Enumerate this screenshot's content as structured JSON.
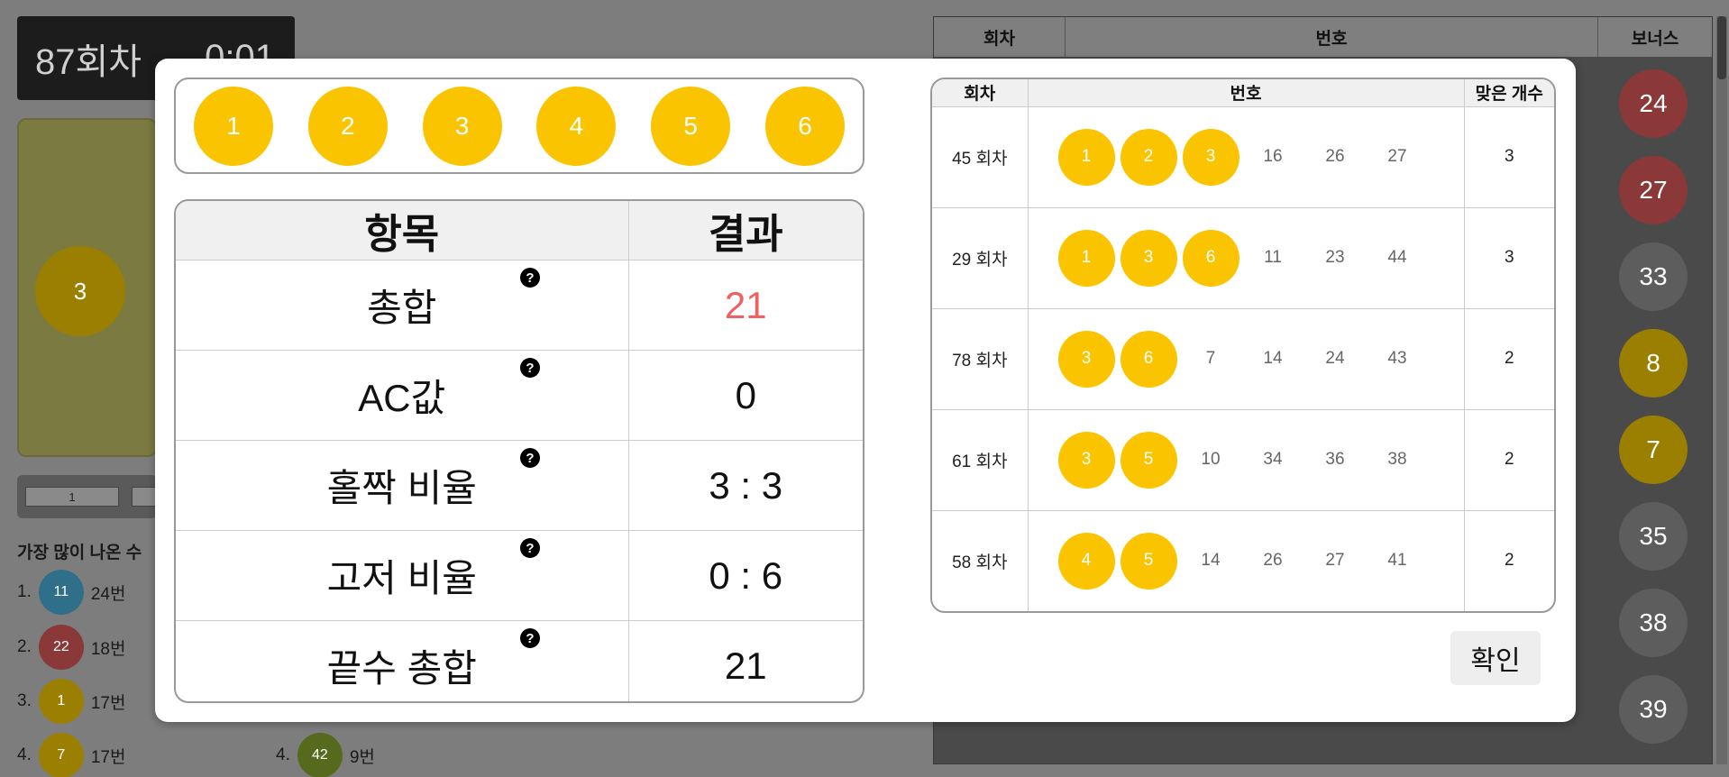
{
  "background": {
    "round_label": "87회차",
    "timer": "0:01",
    "card_ball": "3",
    "pager": [
      "1",
      ""
    ],
    "freq_title": "가장 많이 나온 수",
    "freq": [
      {
        "rank": "1.",
        "ball": "11",
        "count": "24번",
        "color": "blue"
      },
      {
        "rank": "2.",
        "ball": "22",
        "count": "18번",
        "color": "red"
      },
      {
        "rank": "3.",
        "ball": "1",
        "count": "17번",
        "color": "yellow"
      },
      {
        "rank": "4.",
        "ball": "7",
        "count": "17번",
        "color": "yellow"
      },
      {
        "rank": "4.",
        "ball": "42",
        "count": "9번",
        "color": "green"
      }
    ],
    "table_headers": {
      "round": "회차",
      "numbers": "번호",
      "bonus": "보너스"
    },
    "bonus_balls": [
      {
        "value": "24",
        "color": "red"
      },
      {
        "value": "27",
        "color": "red"
      },
      {
        "value": "33",
        "color": "gray"
      },
      {
        "value": "8",
        "color": "yellow"
      },
      {
        "value": "7",
        "color": "yellow"
      },
      {
        "value": "35",
        "color": "gray"
      },
      {
        "value": "38",
        "color": "gray"
      },
      {
        "value": "39",
        "color": "gray"
      }
    ]
  },
  "modal": {
    "selected_numbers": [
      "1",
      "2",
      "3",
      "4",
      "5",
      "6"
    ],
    "stats": {
      "headers": {
        "item": "항목",
        "result": "결과"
      },
      "help_icon": "?",
      "rows": [
        {
          "item": "총합",
          "result": "21",
          "highlight": true
        },
        {
          "item": "AC값",
          "result": "0"
        },
        {
          "item": "홀짝 비율",
          "result": "3 : 3"
        },
        {
          "item": "고저 비율",
          "result": "0 : 6"
        },
        {
          "item": "끝수 총합",
          "result": "21"
        }
      ]
    },
    "history": {
      "headers": {
        "round": "회차",
        "numbers": "번호",
        "matched": "맞은 개수"
      },
      "rows": [
        {
          "round": "45 회차",
          "numbers": [
            "1",
            "2",
            "3",
            "16",
            "26",
            "27"
          ],
          "hits": 3,
          "matched": "3"
        },
        {
          "round": "29 회차",
          "numbers": [
            "1",
            "3",
            "6",
            "11",
            "23",
            "44"
          ],
          "hits": 3,
          "matched": "3"
        },
        {
          "round": "78 회차",
          "numbers": [
            "3",
            "6",
            "7",
            "14",
            "24",
            "43"
          ],
          "hits": 2,
          "matched": "2"
        },
        {
          "round": "61 회차",
          "numbers": [
            "3",
            "5",
            "10",
            "34",
            "36",
            "38"
          ],
          "hits": 2,
          "matched": "2"
        },
        {
          "round": "58 회차",
          "numbers": [
            "4",
            "5",
            "14",
            "26",
            "27",
            "41"
          ],
          "hits": 2,
          "matched": "2"
        }
      ]
    },
    "confirm_label": "확인"
  },
  "colors": {
    "ball_yellow": "#fbc400",
    "highlight_red": "#f06060"
  }
}
